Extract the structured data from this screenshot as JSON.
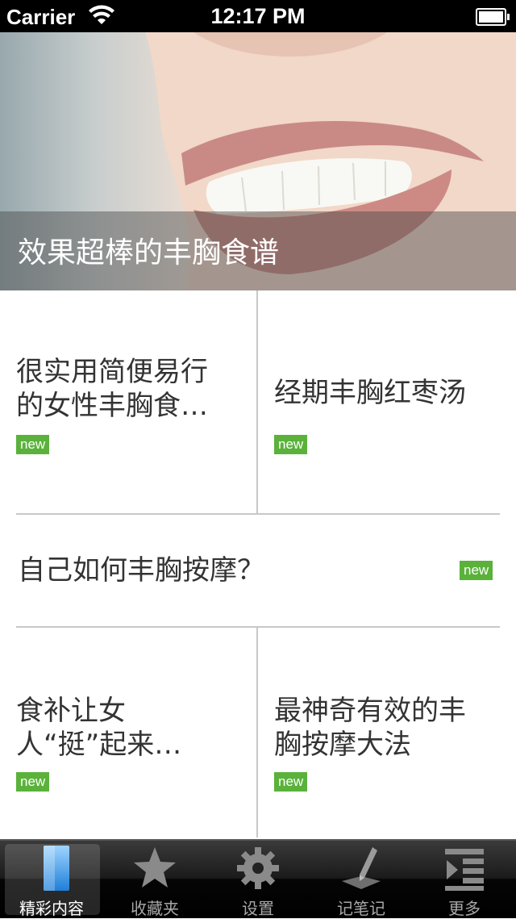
{
  "status_bar": {
    "carrier": "Carrier",
    "time": "12:17 PM"
  },
  "hero": {
    "caption": "效果超棒的丰胸食谱"
  },
  "articles": [
    {
      "title_lines": [
        "很实用简便易行",
        "的女性丰胸食…"
      ],
      "badge": "new"
    },
    {
      "title_lines": [
        "经期丰胸红枣汤"
      ],
      "badge": "new"
    },
    {
      "title_lines": [
        "自己如何丰胸按摩？"
      ],
      "badge": "new"
    },
    {
      "title_lines": [
        "食补让女",
        "人“挺”起来…"
      ],
      "badge": "new"
    },
    {
      "title_lines": [
        "最神奇有效的丰",
        "胸按摩大法"
      ],
      "badge": "new"
    }
  ],
  "tabs": [
    {
      "label": "精彩内容",
      "icon": "featured-icon",
      "active": true
    },
    {
      "label": "收藏夹",
      "icon": "star-icon"
    },
    {
      "label": "设置",
      "icon": "gear-icon"
    },
    {
      "label": "记笔记",
      "icon": "pen-icon"
    },
    {
      "label": "更多",
      "icon": "more-icon"
    }
  ],
  "colors": {
    "badge": "#5ab23b",
    "tab_bar": "#1b1b1b",
    "active_icon": "#2f8fe6"
  }
}
